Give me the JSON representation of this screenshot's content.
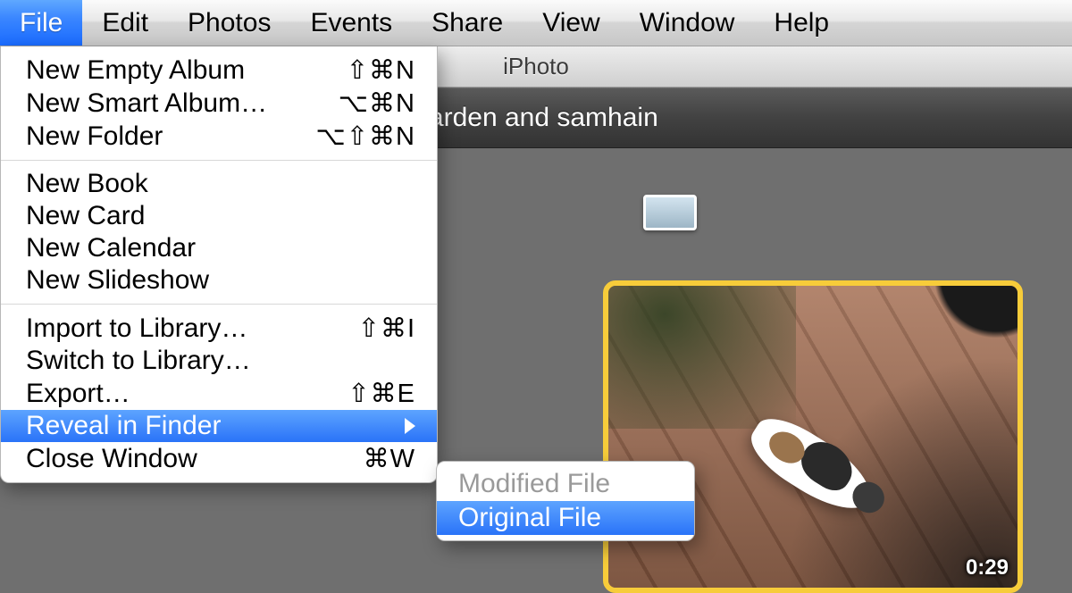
{
  "menubar": {
    "items": [
      {
        "label": "File",
        "active": true
      },
      {
        "label": "Edit"
      },
      {
        "label": "Photos"
      },
      {
        "label": "Events"
      },
      {
        "label": "Share"
      },
      {
        "label": "View"
      },
      {
        "label": "Window"
      },
      {
        "label": "Help"
      }
    ]
  },
  "file_menu": {
    "groups": [
      [
        {
          "label": "New Empty Album",
          "shortcut": "⇧⌘N"
        },
        {
          "label": "New Smart Album…",
          "shortcut": "⌥⌘N"
        },
        {
          "label": "New Folder",
          "shortcut": "⌥⇧⌘N"
        }
      ],
      [
        {
          "label": "New Book"
        },
        {
          "label": "New Card"
        },
        {
          "label": "New Calendar"
        },
        {
          "label": "New Slideshow"
        }
      ],
      [
        {
          "label": "Import to Library…",
          "shortcut": "⇧⌘I"
        },
        {
          "label": "Switch to Library…"
        },
        {
          "label": "Export…",
          "shortcut": "⇧⌘E"
        },
        {
          "label": "Reveal in Finder",
          "submenu": true,
          "highlighted": true
        },
        {
          "label": "Close Window",
          "shortcut": "⌘W"
        }
      ]
    ]
  },
  "reveal_submenu": {
    "items": [
      {
        "label": "Modified File",
        "disabled": true
      },
      {
        "label": "Original File",
        "highlighted": true
      }
    ]
  },
  "window": {
    "app_title": "iPhoto",
    "event_title": "garden and samhain",
    "clip_duration": "0:29"
  }
}
